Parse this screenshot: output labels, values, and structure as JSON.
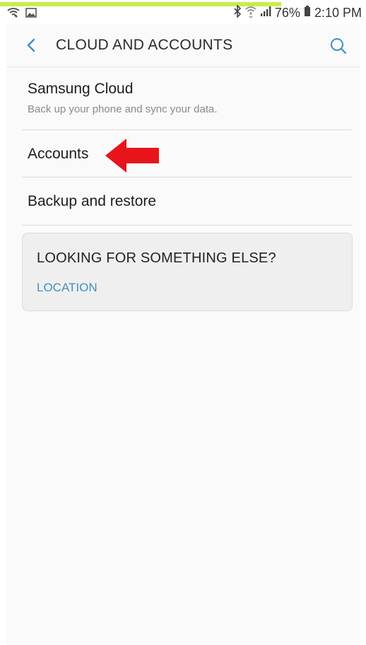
{
  "status_bar": {
    "battery": "76%",
    "time": "2:10 PM",
    "icons": [
      "wifi-call-icon",
      "image-notification-icon",
      "bluetooth-icon",
      "wifi-icon",
      "signal-icon",
      "battery-icon"
    ],
    "progress_fraction": 0.77,
    "progress_color": "#c8ee4a"
  },
  "app_bar": {
    "title": "CLOUD AND ACCOUNTS",
    "back_icon": "chevron-left-icon",
    "search_icon": "search-icon",
    "accent_color": "#3e8fc0"
  },
  "list": {
    "items": [
      {
        "label": "Samsung Cloud",
        "subtitle": "Back up your phone and sync your data."
      },
      {
        "label": "Accounts"
      },
      {
        "label": "Backup and restore"
      }
    ]
  },
  "suggestion_card": {
    "title": "LOOKING FOR SOMETHING ELSE?",
    "link": "LOCATION"
  },
  "annotation": {
    "arrow_icon": "red-arrow-icon",
    "color": "#e8141c"
  }
}
